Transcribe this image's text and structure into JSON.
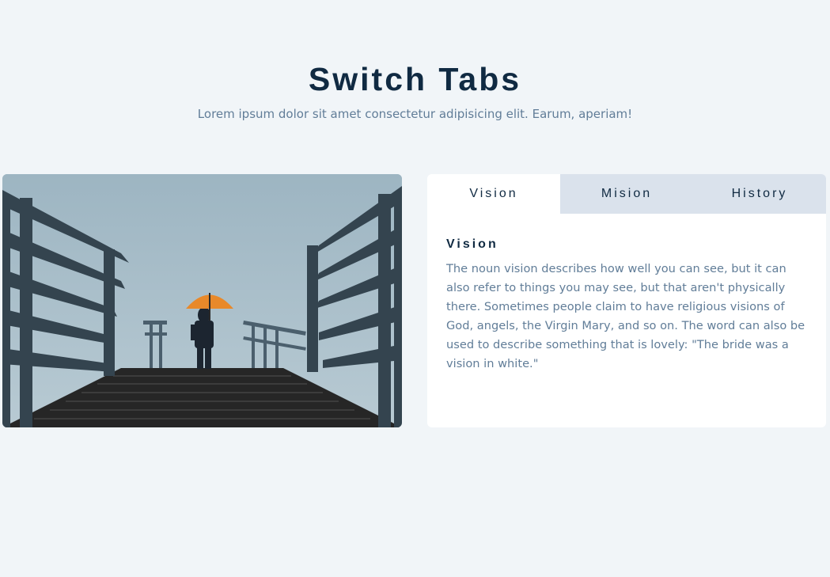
{
  "header": {
    "title": "Switch Tabs",
    "subtitle": "Lorem ipsum dolor sit amet consectetur adipisicing elit. Earum, aperiam!"
  },
  "image": {
    "subject": "person-with-orange-umbrella-on-stairs",
    "colors": {
      "sky": "#a6bcc8",
      "railing": "#3a4a57",
      "umbrella": "#e8892a",
      "stairs": "#2a2a2a"
    }
  },
  "tabs": [
    {
      "label": "Vision",
      "active": true
    },
    {
      "label": "Mision",
      "active": false
    },
    {
      "label": "History",
      "active": false
    }
  ],
  "content": {
    "title": "Vision",
    "text": "The noun vision describes how well you can see, but it can also refer to things you may see, but that aren't physically there. Sometimes people claim to have religious visions of God, angels, the Virgin Mary, and so on. The word can also be used to describe something that is lovely: \"The bride was a vision in white.\""
  },
  "colors": {
    "background": "#f1f5f8",
    "heading": "#102a42",
    "body_text": "#617d98",
    "tab_inactive": "#dae2ec",
    "tab_active": "#ffffff"
  }
}
